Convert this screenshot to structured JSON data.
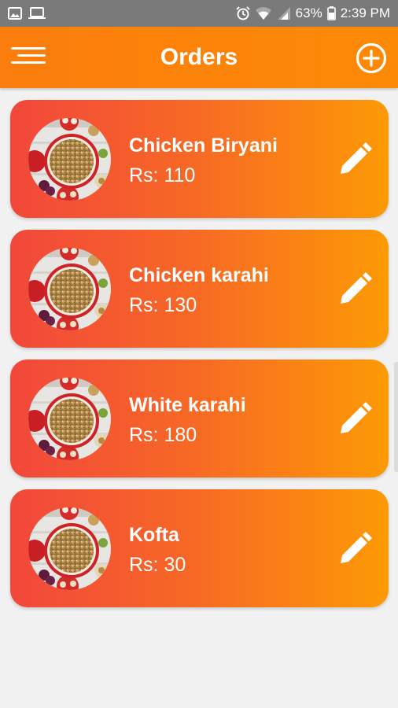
{
  "status_bar": {
    "battery": "63%",
    "time": "2:39 PM"
  },
  "header": {
    "title": "Orders",
    "menu_icon": "hamburger-menu-icon",
    "add_icon": "add-circle-icon"
  },
  "orders": [
    {
      "name": "Chicken Biryani",
      "price": "Rs: 110"
    },
    {
      "name": "Chicken karahi",
      "price": "Rs: 130"
    },
    {
      "name": "White karahi",
      "price": "Rs: 180"
    },
    {
      "name": "Kofta",
      "price": "Rs: 30"
    }
  ],
  "colors": {
    "app_bar": "#fd8a06",
    "card_gradient_start": "#f2473b",
    "card_gradient_end": "#fd9a05",
    "background": "#f1f1f1"
  }
}
